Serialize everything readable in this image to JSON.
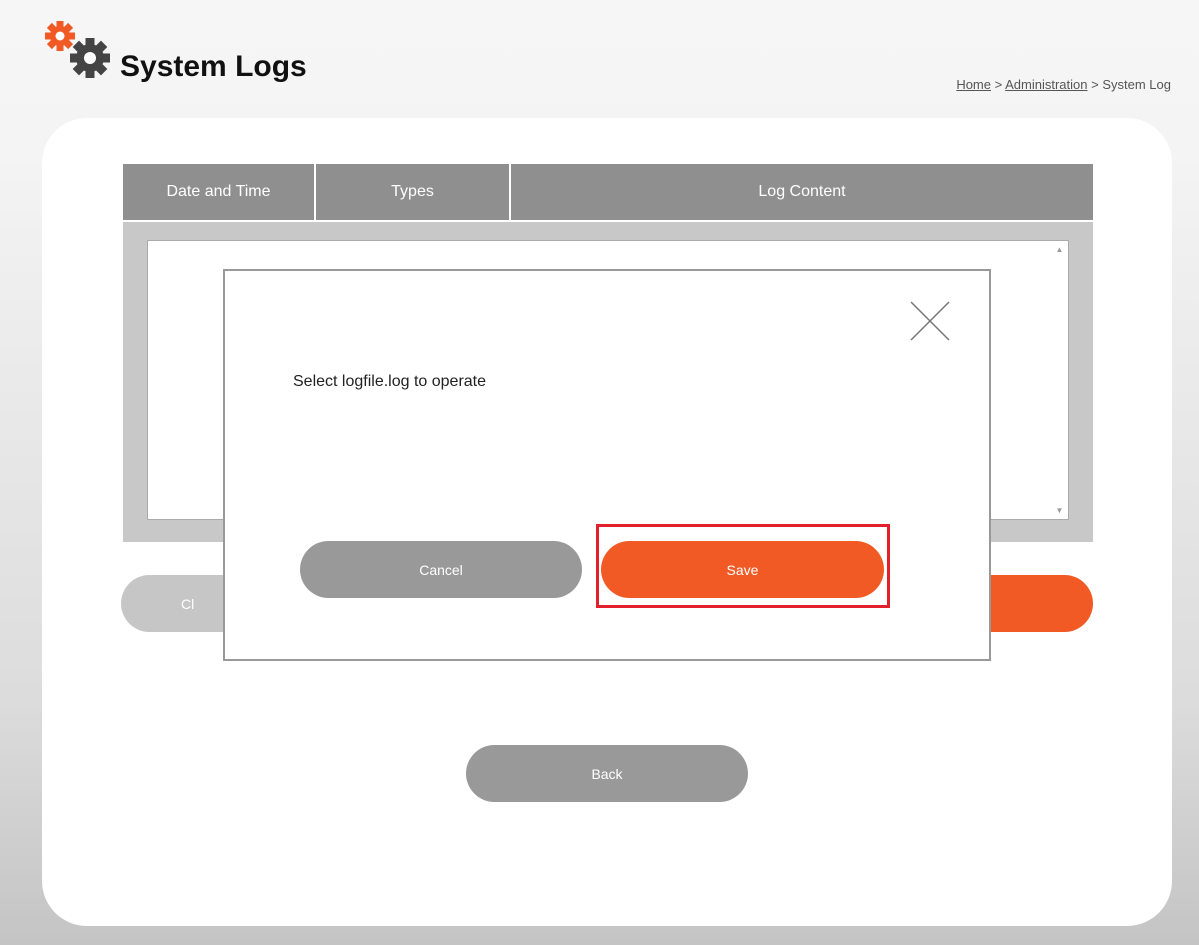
{
  "header": {
    "title": "System Logs",
    "logo_icon": "gears-icon",
    "brand_color": "#f15a24"
  },
  "breadcrumb": {
    "home": "Home",
    "sep1": ">",
    "administration": "Administration",
    "sep2": ">",
    "current": "System Log"
  },
  "log_table": {
    "columns": [
      "Date and Time",
      "Types",
      "Log Content"
    ]
  },
  "background_buttons": {
    "clear_partial": "Cl"
  },
  "modal": {
    "message": "Select logfile.log to operate",
    "close_icon": "close-icon",
    "cancel_label": "Cancel",
    "save_label": "Save",
    "highlight_color": "#e2202b"
  },
  "footer": {
    "back_label": "Back"
  }
}
